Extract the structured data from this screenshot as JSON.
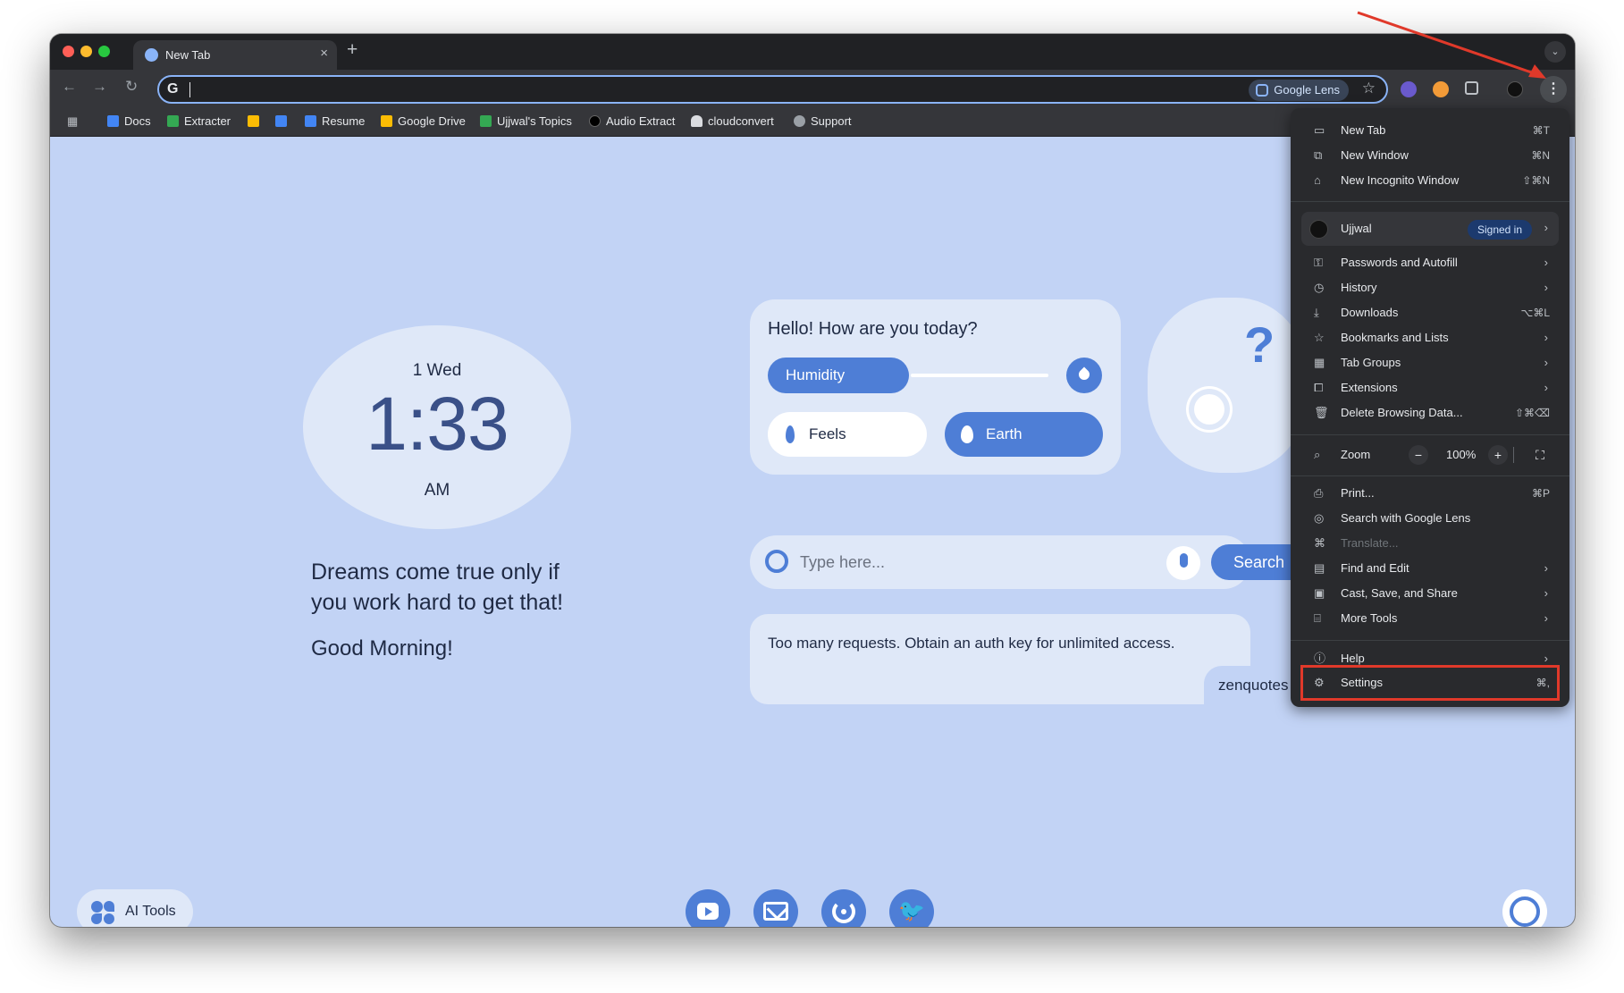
{
  "browser": {
    "tab": {
      "title": "New Tab",
      "close": "×"
    },
    "new_tab_symbol": "+",
    "tab_menu_symbol": "⌄",
    "nav": {
      "back": "←",
      "forward": "→",
      "reload": "↻"
    },
    "omnibox": {
      "engine_glyph": "G",
      "lens_label": "Google Lens",
      "star": "☆"
    },
    "kebab": "⋮",
    "bookmarks": [
      {
        "label": "Docs",
        "color": "#4285f4"
      },
      {
        "label": "Extracter",
        "color": "#34a853"
      },
      {
        "label": "",
        "color": "#fbbc04"
      },
      {
        "label": "",
        "color": "#4285f4"
      },
      {
        "label": "Resume",
        "color": "#4285f4"
      },
      {
        "label": "Google Drive",
        "color": "#fbbc04"
      },
      {
        "label": "Ujjwal's Topics",
        "color": "#34a853"
      },
      {
        "label": "Audio Extract",
        "color": "#000000"
      },
      {
        "label": "cloudconvert",
        "color": "#dadce0"
      },
      {
        "label": "Support",
        "color": "#9aa0a6"
      }
    ]
  },
  "newtab": {
    "clock": {
      "date": "1 Wed",
      "time": "1:33",
      "ampm": "AM"
    },
    "quote": "Dreams come true only if you work hard to get that!",
    "greeting": "Good Morning!",
    "weather": {
      "hello": "Hello! How are you today?",
      "humidity": "Humidity",
      "feels": "Feels",
      "earth": "Earth",
      "question": "?"
    },
    "search": {
      "placeholder": "Type here...",
      "button": "Search"
    },
    "quote_card": {
      "text": "Too many requests. Obtain an auth key for unlimited access.",
      "author": "zenquotes"
    },
    "ai_tools": "AI Tools",
    "twitter_glyph": "🐦"
  },
  "menu": {
    "new_tab": {
      "label": "New Tab",
      "shortcut": "⌘T"
    },
    "new_window": {
      "label": "New Window",
      "shortcut": "⌘N"
    },
    "new_incognito": {
      "label": "New Incognito Window",
      "shortcut": "⇧⌘N"
    },
    "profile": {
      "name": "Ujjwal",
      "status": "Signed in"
    },
    "passwords": {
      "label": "Passwords and Autofill"
    },
    "history": {
      "label": "History"
    },
    "downloads": {
      "label": "Downloads",
      "shortcut": "⌥⌘L"
    },
    "bookmarks": {
      "label": "Bookmarks and Lists"
    },
    "tab_groups": {
      "label": "Tab Groups"
    },
    "extensions": {
      "label": "Extensions"
    },
    "delete_data": {
      "label": "Delete Browsing Data...",
      "shortcut": "⇧⌘⌫"
    },
    "zoom": {
      "label": "Zoom",
      "minus": "−",
      "value": "100%",
      "plus": "+",
      "fullscreen": "⛶"
    },
    "print": {
      "label": "Print...",
      "shortcut": "⌘P"
    },
    "lens": {
      "label": "Search with Google Lens"
    },
    "translate": {
      "label": "Translate..."
    },
    "find_edit": {
      "label": "Find and Edit"
    },
    "cast_save": {
      "label": "Cast, Save, and Share"
    },
    "more_tools": {
      "label": "More Tools"
    },
    "help": {
      "label": "Help"
    },
    "settings": {
      "label": "Settings",
      "shortcut": "⌘,"
    }
  },
  "colors": {
    "accent": "#4e7ed6",
    "page_bg": "#c2d3f5",
    "highlight": "#e0392a"
  }
}
